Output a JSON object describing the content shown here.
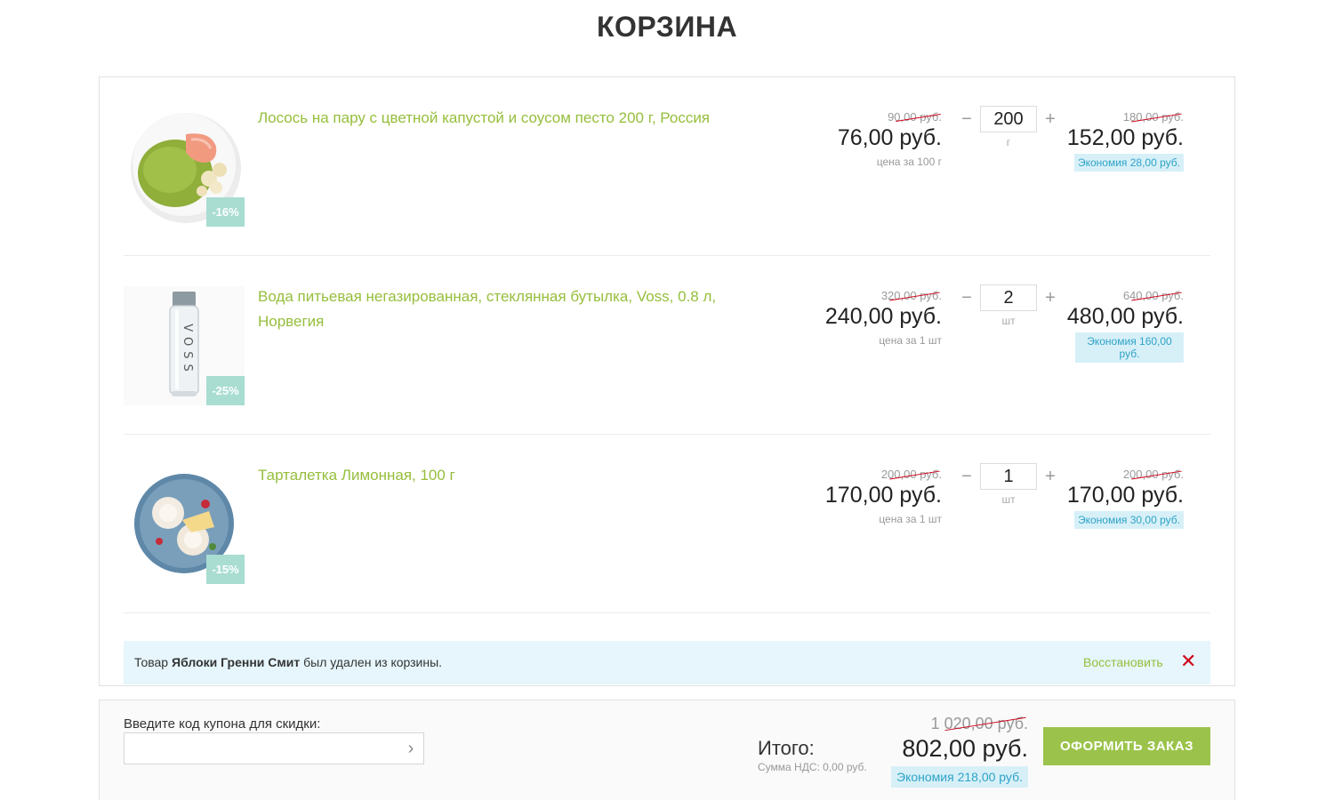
{
  "page": {
    "title": "КОРЗИНА"
  },
  "items": [
    {
      "name": "Лосось на пару с цветной капустой и соусом песто 200 г, Россия",
      "discount": "-16%",
      "old_unit_price": "90,00 руб.",
      "unit_price": "76,00 руб.",
      "unit_note": "цена за 100 г",
      "qty": "200",
      "qty_unit": "г",
      "old_sum": "180,00 руб.",
      "sum": "152,00 руб.",
      "saving": "Экономия 28,00 руб.",
      "image_icon": "salmon-plate-icon"
    },
    {
      "name": "Вода питьевая негазированная, стеклянная бутылка, Voss, 0.8 л, Норвегия",
      "discount": "-25%",
      "old_unit_price": "320,00 руб.",
      "unit_price": "240,00 руб.",
      "unit_note": "цена за 1 шт",
      "qty": "2",
      "qty_unit": "шт",
      "old_sum": "640,00 руб.",
      "sum": "480,00 руб.",
      "saving": "Экономия 160,00 руб.",
      "image_icon": "water-bottle-icon",
      "bottle_label": "VOSS"
    },
    {
      "name": "Тарталетка Лимонная, 100 г",
      "discount": "-15%",
      "old_unit_price": "200,00 руб.",
      "unit_price": "170,00 руб.",
      "unit_note": "цена за 1 шт",
      "qty": "1",
      "qty_unit": "шт",
      "old_sum": "200,00 руб.",
      "sum": "170,00 руб.",
      "saving": "Экономия 30,00 руб.",
      "image_icon": "tartlet-plate-icon"
    }
  ],
  "qty_controls": {
    "minus": "−",
    "plus": "+"
  },
  "removed_notice": {
    "prefix": "Товар",
    "product": "Яблоки Гренни Смит",
    "suffix": "был удален из корзины.",
    "restore_label": "Восстановить",
    "close_glyph": "✕"
  },
  "coupon": {
    "label": "Введите код купона для скидки:",
    "value": "",
    "go_glyph": "›"
  },
  "totals": {
    "label": "Итого:",
    "vat_note": "Сумма НДС: 0,00 руб.",
    "old_total": "1 020,00 руб.",
    "total": "802,00 руб.",
    "saving": "Экономия 218,00 руб."
  },
  "checkout": {
    "label": "ОФОРМИТЬ ЗАКАЗ"
  },
  "colors": {
    "accent_green": "#96be3c",
    "button_green": "#9bc34b",
    "discount_badge": "#a9ddd2",
    "saving_bg": "#d7f0f8",
    "saving_text": "#2ea3c7",
    "notice_bg": "#e6f6fc",
    "strike_red": "#d0021b"
  }
}
